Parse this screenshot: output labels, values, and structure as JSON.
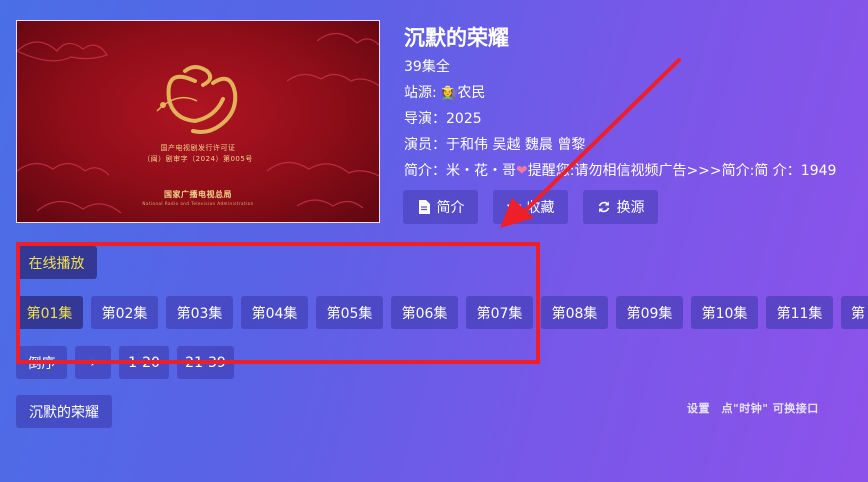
{
  "poster": {
    "line1": "国产电视剧发行许可证",
    "line2": "（闽）剧审字（2024）第005号",
    "line3": "国家广播电视总局",
    "line4": "National Radio and Television Administration"
  },
  "title": "沉默的荣耀",
  "episodes_total": "39集全",
  "source": {
    "label": "站源: ",
    "emoji_name": "farmer-emoji",
    "value": "农民"
  },
  "director": "导演：2025",
  "actors": "演员：于和伟 吴越 魏晨 曾黎",
  "synopsis": {
    "prefix": "简介：米・花・哥",
    "suffix": "提醒您:请勿相信视频广告>>>简介:简 介：1949"
  },
  "actions": [
    {
      "label": "简介",
      "icon": "document-icon"
    },
    {
      "label": "收藏",
      "icon": "star-icon"
    },
    {
      "label": "换源",
      "icon": "refresh-icon"
    }
  ],
  "play_source_label": "在线播放",
  "episodes": [
    "第01集",
    "第02集",
    "第03集",
    "第04集",
    "第05集",
    "第06集",
    "第07集",
    "第08集",
    "第09集",
    "第10集",
    "第11集",
    "第"
  ],
  "selected_episode": "第01集",
  "sort": {
    "reverse": "倒序",
    "arrow": "›",
    "range1": "1-20",
    "range2": "21-39"
  },
  "series_chip": "沉默的荣耀",
  "hint": "设置　点\"时钟\" 可换接口",
  "colors": {
    "accent_yellow": "#f2e24a",
    "annotation_red": "#ef1f2a"
  }
}
